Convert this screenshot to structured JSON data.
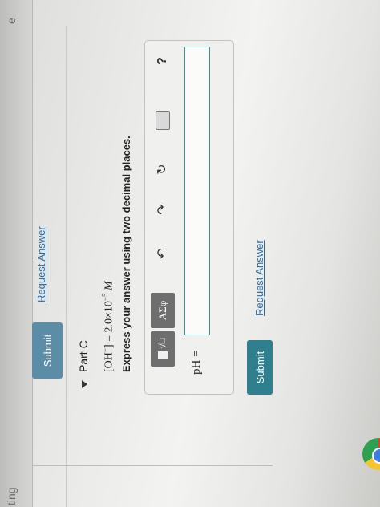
{
  "left_panel": {
    "fragment_top": "e",
    "fragment_bottom": "ting"
  },
  "previous_part": {
    "submit_label": "Submit",
    "request_answer_label": "Request Answer"
  },
  "part": {
    "title": "Part C",
    "concentration_prefix": "[OH",
    "concentration_sup": "−",
    "concentration_mid": "] = 2.0×10",
    "concentration_exp": "−5",
    "concentration_unit": " M",
    "instruction": "Express your answer using two decimal places."
  },
  "toolbar": {
    "matrix_label": "√□",
    "greek_label": "ΑΣφ",
    "undo_icon": "undo-icon",
    "redo_icon": "redo-icon",
    "reset_icon": "reset-icon",
    "keyboard_icon": "keyboard-icon",
    "help_label": "?"
  },
  "answer": {
    "label": "pH =",
    "value": ""
  },
  "actions": {
    "submit_label": "Submit",
    "request_answer_label": "Request Answer"
  }
}
